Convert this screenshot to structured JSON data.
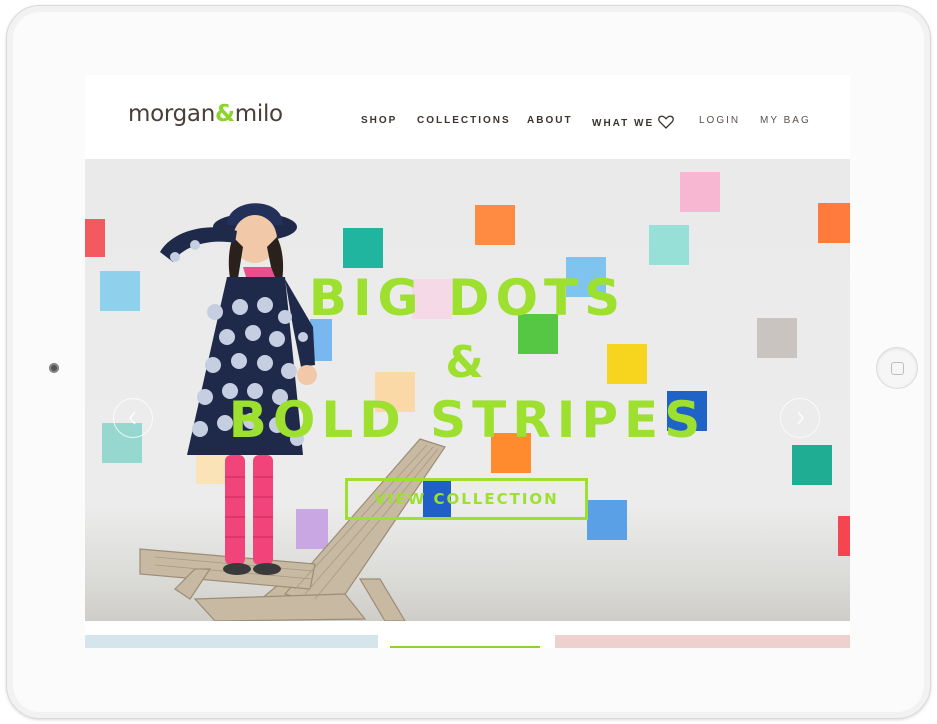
{
  "brand": {
    "name_left": "morgan",
    "amp": "&",
    "name_right": "milo"
  },
  "nav": {
    "shop": "SHOP",
    "collections": "COLLECTIONS",
    "about": "ABOUT",
    "what_we": "WHAT WE",
    "login": "LOGIN",
    "bag": "MY BAG"
  },
  "icons": {
    "heart": "heart-icon",
    "prev": "chevron-left-icon",
    "next": "chevron-right-icon",
    "home": "home-button-icon"
  },
  "hero": {
    "line1": "BIG DOTS",
    "line2": "&",
    "line3": "BOLD STRIPES",
    "cta": "VIEW COLLECTION"
  },
  "colors": {
    "accent_green": "#9de02f",
    "logo_brown": "#4a3f38",
    "strip_left": "#d4e6ec",
    "strip_mid": "#8bd42a",
    "strip_right": "#eed0cf"
  }
}
